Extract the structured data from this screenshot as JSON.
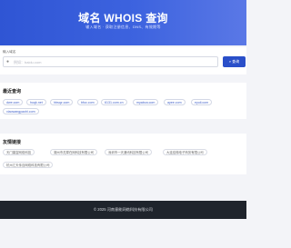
{
  "header": {
    "title": "域名 WHOIS 查询",
    "subtitle": "输入域名 · 获取注册信息、DNS、有效期等"
  },
  "search": {
    "label": "输入域名",
    "placeholder": "例如：baidu.com",
    "button_label": "查询",
    "button_icon": "search-icon"
  },
  "recent": {
    "title": "最近查询",
    "items": [
      "dwe.com",
      "huqk.net",
      "hbsqz.com",
      "bfoc.com",
      "6131.com.cn",
      "myabca.com",
      "ayee.com",
      "eyuil.com",
      "xiaowangyaohl.com"
    ]
  },
  "friends": {
    "title": "友情链接",
    "items": [
      "天门康富网络科技",
      "湖州市灵犀在网科技有限公司",
      "深圳市一天通讯科技有限公司",
      "大连佳梯电子商务有限公司",
      "杭州江天传百网络科技有限公司"
    ]
  },
  "footer": {
    "text": "© 2025 河南意能网络科技有限公司"
  },
  "colors": {
    "brand": "#2f55d4",
    "button": "#2a4fc9",
    "link": "#3e5fc8",
    "footer_bg": "#1f242c"
  }
}
